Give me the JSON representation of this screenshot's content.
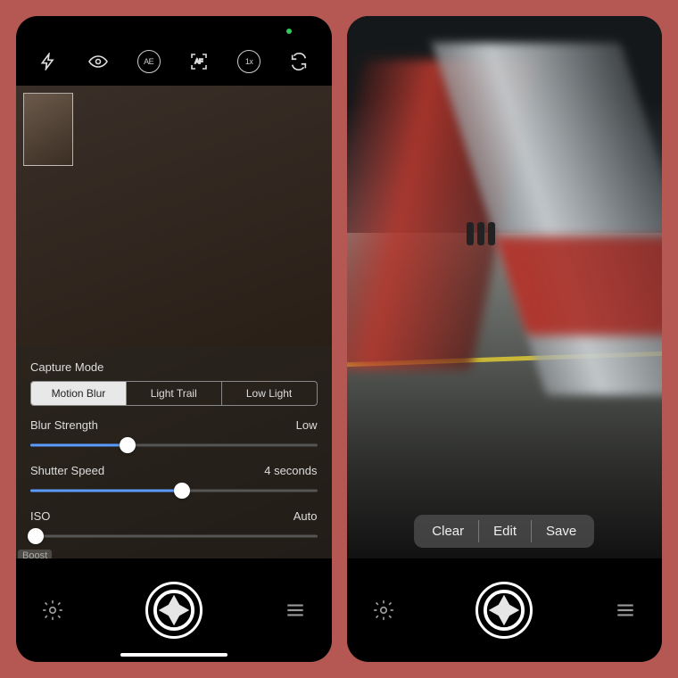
{
  "left": {
    "topbar": {
      "ae": "AE",
      "af": "AF",
      "zoom": "1x"
    },
    "panel": {
      "title": "Capture Mode",
      "modes": [
        "Motion Blur",
        "Light Trail",
        "Low Light"
      ],
      "active_mode": 0,
      "sliders": [
        {
          "label": "Blur Strength",
          "value": "Low",
          "fill": 34
        },
        {
          "label": "Shutter Speed",
          "value": "4 seconds",
          "fill": 53
        },
        {
          "label": "ISO",
          "value": "Auto",
          "fill": 2
        }
      ],
      "tag": "Boost"
    }
  },
  "right": {
    "actions": [
      "Clear",
      "Edit",
      "Save"
    ]
  }
}
